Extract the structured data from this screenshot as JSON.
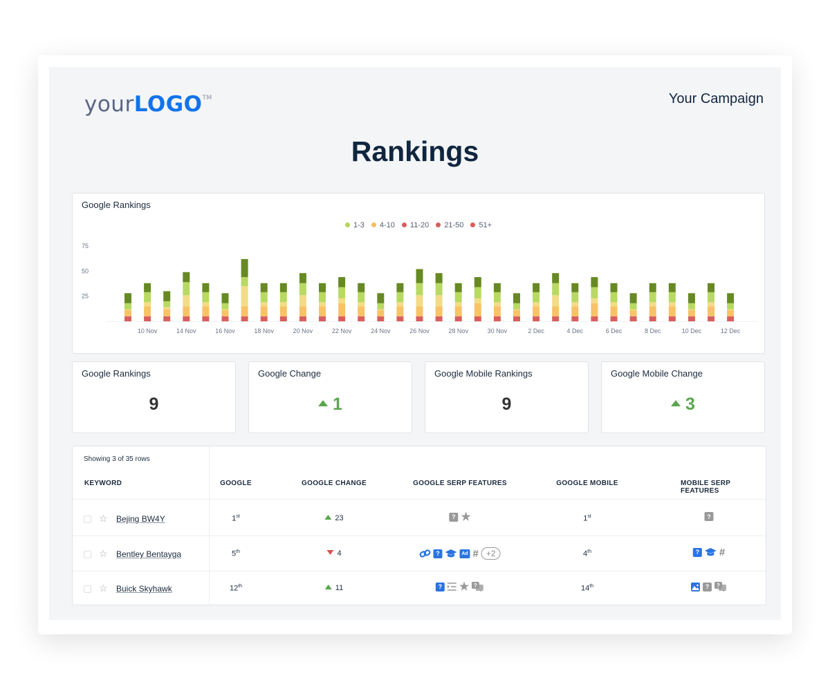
{
  "header": {
    "logo_part1": "your",
    "logo_part2": "LOGO",
    "logo_tm": "TM",
    "campaign": "Your Campaign",
    "title": "Rankings"
  },
  "chart_data": {
    "type": "bar",
    "stacked": true,
    "title": "Google Rankings",
    "legend": [
      {
        "label": "1-3",
        "color": "#b5d65a"
      },
      {
        "label": "4-10",
        "color": "#f6bf5a"
      },
      {
        "label": "11-20",
        "color": "#d95c5c"
      },
      {
        "label": "21-50",
        "color": "#d95c5c"
      },
      {
        "label": "51+",
        "color": "#d95c5c"
      }
    ],
    "legend_position": "top",
    "segment_colors": [
      "#d95f5f",
      "#f7c366",
      "#f3dc86",
      "#b8d962",
      "#678923"
    ],
    "y_ticks": [
      25,
      50,
      75
    ],
    "ylim": [
      0,
      75
    ],
    "x_tick_labels": [
      "10 Nov",
      "14 Nov",
      "16 Nov",
      "18 Nov",
      "20 Nov",
      "22 Nov",
      "24 Nov",
      "26 Nov",
      "28 Nov",
      "30 Nov",
      "2 Dec",
      "4 Dec",
      "6 Dec",
      "8 Dec",
      "10 Dec",
      "12 Dec"
    ],
    "bars": [
      [
        5,
        6,
        1,
        6,
        10
      ],
      [
        5,
        10,
        4,
        10,
        9
      ],
      [
        5,
        7,
        2,
        6,
        10
      ],
      [
        5,
        10,
        11,
        13,
        10
      ],
      [
        5,
        10,
        4,
        10,
        9
      ],
      [
        5,
        6,
        1,
        6,
        10
      ],
      [
        5,
        10,
        20,
        9,
        18
      ],
      [
        5,
        10,
        4,
        10,
        9
      ],
      [
        5,
        10,
        4,
        10,
        9
      ],
      [
        5,
        10,
        11,
        12,
        10
      ],
      [
        5,
        10,
        4,
        10,
        9
      ],
      [
        5,
        13,
        5,
        11,
        10
      ],
      [
        5,
        10,
        4,
        10,
        9
      ],
      [
        5,
        6,
        1,
        6,
        10
      ],
      [
        5,
        10,
        4,
        10,
        9
      ],
      [
        5,
        10,
        11,
        12,
        14
      ],
      [
        5,
        10,
        11,
        12,
        10
      ],
      [
        5,
        10,
        4,
        10,
        9
      ],
      [
        5,
        13,
        5,
        11,
        10
      ],
      [
        5,
        10,
        4,
        10,
        9
      ],
      [
        5,
        6,
        1,
        6,
        10
      ],
      [
        5,
        10,
        4,
        10,
        9
      ],
      [
        5,
        10,
        11,
        12,
        10
      ],
      [
        5,
        10,
        4,
        10,
        9
      ],
      [
        5,
        13,
        5,
        11,
        10
      ],
      [
        5,
        10,
        4,
        10,
        9
      ],
      [
        5,
        6,
        1,
        6,
        10
      ],
      [
        5,
        10,
        4,
        10,
        9
      ],
      [
        5,
        10,
        4,
        10,
        9
      ],
      [
        5,
        6,
        1,
        6,
        10
      ],
      [
        5,
        10,
        4,
        10,
        9
      ],
      [
        5,
        6,
        1,
        6,
        10
      ]
    ],
    "grid": false
  },
  "kpis": [
    {
      "title": "Google Rankings",
      "value": "9",
      "trend": "none"
    },
    {
      "title": "Google Change",
      "value": "1",
      "trend": "up"
    },
    {
      "title": "Google Mobile Rankings",
      "value": "9",
      "trend": "none"
    },
    {
      "title": "Google Mobile Change",
      "value": "3",
      "trend": "up"
    }
  ],
  "table": {
    "showing": "Showing 3 of 35 rows",
    "headers": [
      "KEYWORD",
      "GOOGLE",
      "GOOGLE CHANGE",
      "GOOGLE SERP FEATURES",
      "GOOGLE MOBILE",
      "MOBILE SERP FEATURES"
    ],
    "rows": [
      {
        "keyword": "Bejing BW4Y",
        "google": "1",
        "google_suffix": "st",
        "change": "23",
        "change_dir": "up",
        "serp": [
          {
            "icon": "question-box",
            "color": "#999999"
          },
          {
            "icon": "star",
            "color": "#999999"
          }
        ],
        "mobile": "1",
        "mobile_suffix": "st",
        "mobile_serp": [
          {
            "icon": "question-box",
            "color": "#999999"
          }
        ]
      },
      {
        "keyword": "Bentley Bentayga",
        "google": "5",
        "google_suffix": "th",
        "change": "4",
        "change_dir": "down",
        "serp": [
          {
            "icon": "link",
            "color": "#2a74e0"
          },
          {
            "icon": "question-box",
            "color": "#2a74e0"
          },
          {
            "icon": "graduation-cap",
            "color": "#2a74e0"
          },
          {
            "icon": "ad",
            "color": "#2a74e0",
            "label": "Ad"
          },
          {
            "icon": "hash",
            "color": "#888888"
          },
          {
            "icon": "more",
            "label": "+2"
          }
        ],
        "mobile": "4",
        "mobile_suffix": "th",
        "mobile_serp": [
          {
            "icon": "question-box",
            "color": "#2a74e0"
          },
          {
            "icon": "graduation-cap",
            "color": "#2a74e0"
          },
          {
            "icon": "hash",
            "color": "#888888"
          }
        ]
      },
      {
        "keyword": "Buick Skyhawk",
        "google": "12",
        "google_suffix": "th",
        "change": "11",
        "change_dir": "up",
        "serp": [
          {
            "icon": "question-box",
            "color": "#2a74e0"
          },
          {
            "icon": "list",
            "color": "#999999"
          },
          {
            "icon": "star",
            "color": "#999999"
          },
          {
            "icon": "question-answer",
            "color": "#999999"
          }
        ],
        "mobile": "14",
        "mobile_suffix": "th",
        "mobile_serp": [
          {
            "icon": "image",
            "color": "#2a74e0"
          },
          {
            "icon": "question-box",
            "color": "#999999"
          },
          {
            "icon": "question-answer",
            "color": "#999999"
          }
        ]
      }
    ]
  }
}
